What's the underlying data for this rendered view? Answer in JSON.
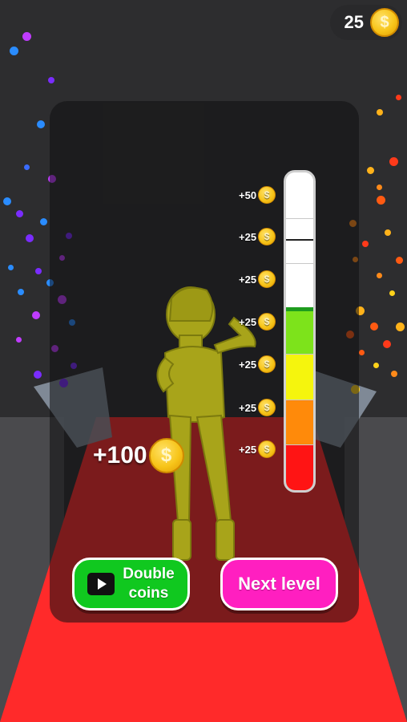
{
  "hud": {
    "coin_count": "25",
    "coin_symbol": "$"
  },
  "meter": {
    "ticks": [
      {
        "label": "+50"
      },
      {
        "label": "+25"
      },
      {
        "label": "+25"
      },
      {
        "label": "+25"
      },
      {
        "label": "+25"
      },
      {
        "label": "+25"
      },
      {
        "label": "+25"
      }
    ],
    "fill_level": 0.55,
    "segment_colors": [
      "#ffffff",
      "#ffffff",
      "#ffffff",
      "#7de31b",
      "#f5f50d",
      "#ff8a0a",
      "#ff1414"
    ],
    "marker_color": "#1e9c1e"
  },
  "reward": {
    "amount": "+100",
    "coin_symbol": "$"
  },
  "buttons": {
    "double_coins": "Double\ncoins",
    "next_level": "Next level"
  },
  "colors": {
    "runway": "#ff2b2b",
    "runway_dark": "#7a1414",
    "character": "#a8a41a",
    "double_button": "#10c81f",
    "next_button": "#ff1fc0"
  }
}
